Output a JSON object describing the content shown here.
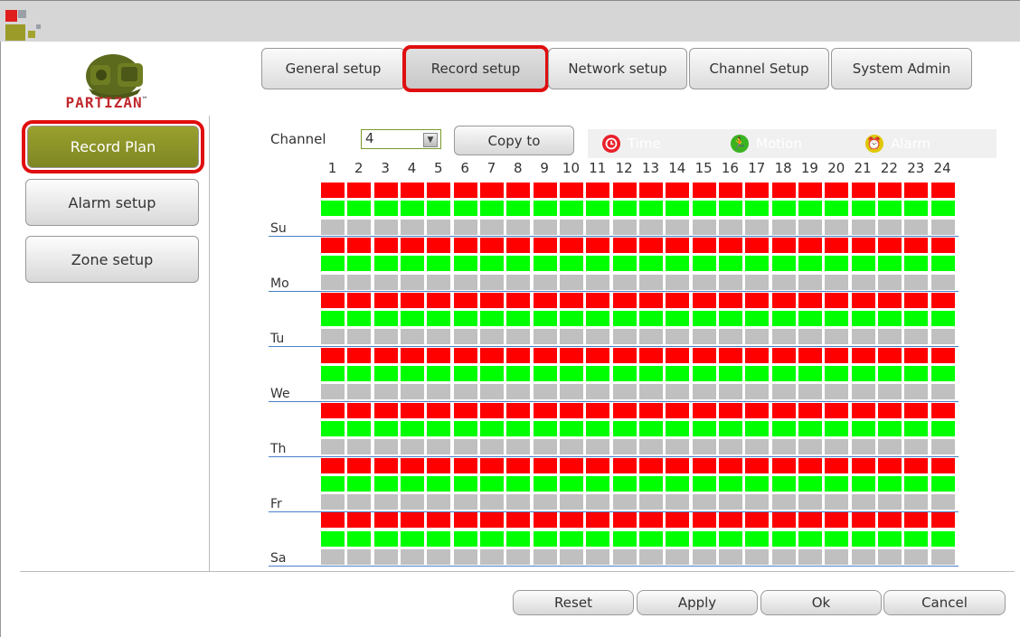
{
  "logo": {
    "text": "PARTIZAN",
    "tm": "™"
  },
  "tabs": [
    {
      "id": "general",
      "label": "General setup"
    },
    {
      "id": "record",
      "label": "Record setup"
    },
    {
      "id": "network",
      "label": "Network setup"
    },
    {
      "id": "channel",
      "label": "Channel Setup"
    },
    {
      "id": "system",
      "label": "System Admin"
    }
  ],
  "sidebar": [
    {
      "id": "record-plan",
      "label": "Record Plan"
    },
    {
      "id": "alarm-setup",
      "label": "Alarm setup"
    },
    {
      "id": "zone-setup",
      "label": "Zone setup"
    }
  ],
  "channel": {
    "label": "Channel",
    "value": "4",
    "copy_label": "Copy to"
  },
  "legend": [
    {
      "id": "time",
      "label": "Time",
      "color": "#e8202a",
      "icon": "clock-icon"
    },
    {
      "id": "motion",
      "label": "Motion",
      "color": "#39b320",
      "icon": "running-man-icon"
    },
    {
      "id": "alarm",
      "label": "Alarm",
      "color": "#e0c800",
      "icon": "alarm-bell-icon"
    }
  ],
  "hours": [
    "1",
    "2",
    "3",
    "4",
    "5",
    "6",
    "7",
    "8",
    "9",
    "10",
    "11",
    "12",
    "13",
    "14",
    "15",
    "16",
    "17",
    "18",
    "19",
    "20",
    "21",
    "22",
    "23",
    "24"
  ],
  "days": [
    "Su",
    "Mo",
    "Tu",
    "We",
    "Th",
    "Fr",
    "Sa"
  ],
  "schedule": {
    "time_enabled_hours": 24,
    "motion_enabled_hours": 24,
    "alarm_enabled_hours": 0,
    "colors": {
      "time": "#ff0000",
      "motion": "#00ff00",
      "off": "#c0c0c0"
    }
  },
  "footer": {
    "reset": "Reset",
    "apply": "Apply",
    "ok": "Ok",
    "cancel": "Cancel"
  }
}
